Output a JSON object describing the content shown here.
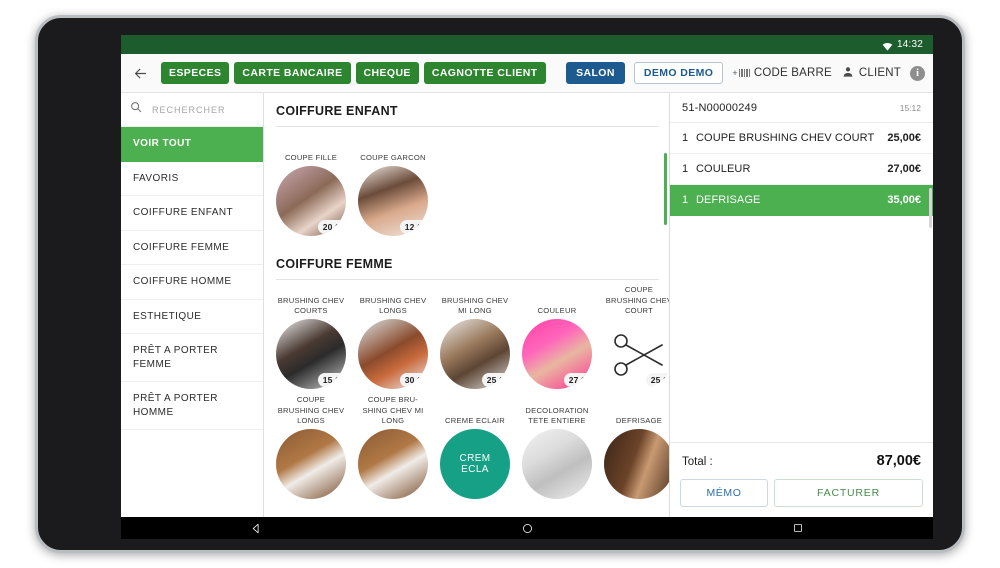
{
  "status_bar": {
    "time": "14:32",
    "wifi_icon": "wifi-icon"
  },
  "toolbar": {
    "back_icon": "back-arrow-icon",
    "payment_buttons": [
      {
        "label": "ESPECES"
      },
      {
        "label": "CARTE BANCAIRE"
      },
      {
        "label": "CHEQUE"
      },
      {
        "label": "CAGNOTTE CLIENT"
      }
    ],
    "salon_label": "SALON",
    "demo_label": "DEMO DEMO",
    "barcode_label": "CODE BARRE",
    "barcode_icon": "barcode-icon",
    "client_label": "CLIENT",
    "client_icon": "person-icon",
    "info_icon": "info-icon",
    "info_glyph": "i"
  },
  "sidebar": {
    "search_placeholder": "RECHERCHER",
    "search_value": "",
    "search_icon": "search-icon",
    "items": [
      {
        "label": "VOIR TOUT",
        "active": true
      },
      {
        "label": "FAVORIS",
        "active": false
      },
      {
        "label": "COIFFURE ENFANT",
        "active": false
      },
      {
        "label": "COIFFURE FEMME",
        "active": false
      },
      {
        "label": "COIFFURE HOMME",
        "active": false
      },
      {
        "label": "ESTHETIQUE",
        "active": false
      },
      {
        "label": "PRÊT A PORTER FEMME",
        "active": false
      },
      {
        "label": "PRÊT A PORTER HOMME",
        "active": false
      }
    ]
  },
  "catalog": {
    "sections": [
      {
        "title": "COIFFURE ENFANT",
        "products": [
          {
            "label": "COUPE FILLE",
            "price": "20,00",
            "art": "ph-fille"
          },
          {
            "label": "COUPE GARCON",
            "price": "12,00",
            "art": "ph-garcon"
          }
        ]
      },
      {
        "title": "COIFFURE FEMME",
        "products": [
          {
            "label": "BRUSHING CHEV COURTS",
            "price": "15,00",
            "art": "ph-brush1"
          },
          {
            "label": "BRUSHING CHEV LONGS",
            "price": "30,00",
            "art": "ph-brush2"
          },
          {
            "label": "BRUSHING CHEV MI LONG",
            "price": "25,00",
            "art": "ph-brush3"
          },
          {
            "label": "COULEUR",
            "price": "27,00",
            "art": "ph-couleur"
          },
          {
            "label": "COUPE BRUSHING CHEV COURT",
            "price": "25,00",
            "art": "ph-ciseaux"
          }
        ]
      },
      {
        "title": "",
        "products": [
          {
            "label": "COUPE BRUSHING CHEV LONGS",
            "price": "",
            "art": "ph-wood"
          },
          {
            "label": "COUPE BRU-SHING CHEV MI LONG",
            "price": "",
            "art": "ph-wood"
          },
          {
            "label": "CREME ECLAIR",
            "price": "",
            "art": "ph-crem",
            "badge_line1": "CREM",
            "badge_line2": "ECLA"
          },
          {
            "label": "DECOLORATION TETE ENTIERE",
            "price": "",
            "art": "ph-deco"
          },
          {
            "label": "DEFRISAGE",
            "price": "",
            "art": "ph-defris"
          }
        ]
      }
    ]
  },
  "receipt": {
    "order_id": "51-N00000249",
    "time": "15:12",
    "lines": [
      {
        "qty": "1",
        "name": "COUPE BRUSHING CHEV COURT",
        "amount": "25,00€",
        "selected": false
      },
      {
        "qty": "1",
        "name": "COULEUR",
        "amount": "27,00€",
        "selected": false
      },
      {
        "qty": "1",
        "name": "DEFRISAGE",
        "amount": "35,00€",
        "selected": true
      }
    ],
    "total_label": "Total :",
    "total_value": "87,00€",
    "memo_label": "MÉMO",
    "facturer_label": "FACTURER"
  },
  "navbar": {
    "back_icon": "android-back-icon",
    "home_icon": "android-home-icon",
    "recents_icon": "android-recents-icon"
  },
  "colors": {
    "status_green": "#1d5c2c",
    "payment_green": "#2d8530",
    "accent_green": "#4caf50",
    "salon_blue": "#1d5a8f",
    "memo_blue": "#2d6ea8"
  }
}
